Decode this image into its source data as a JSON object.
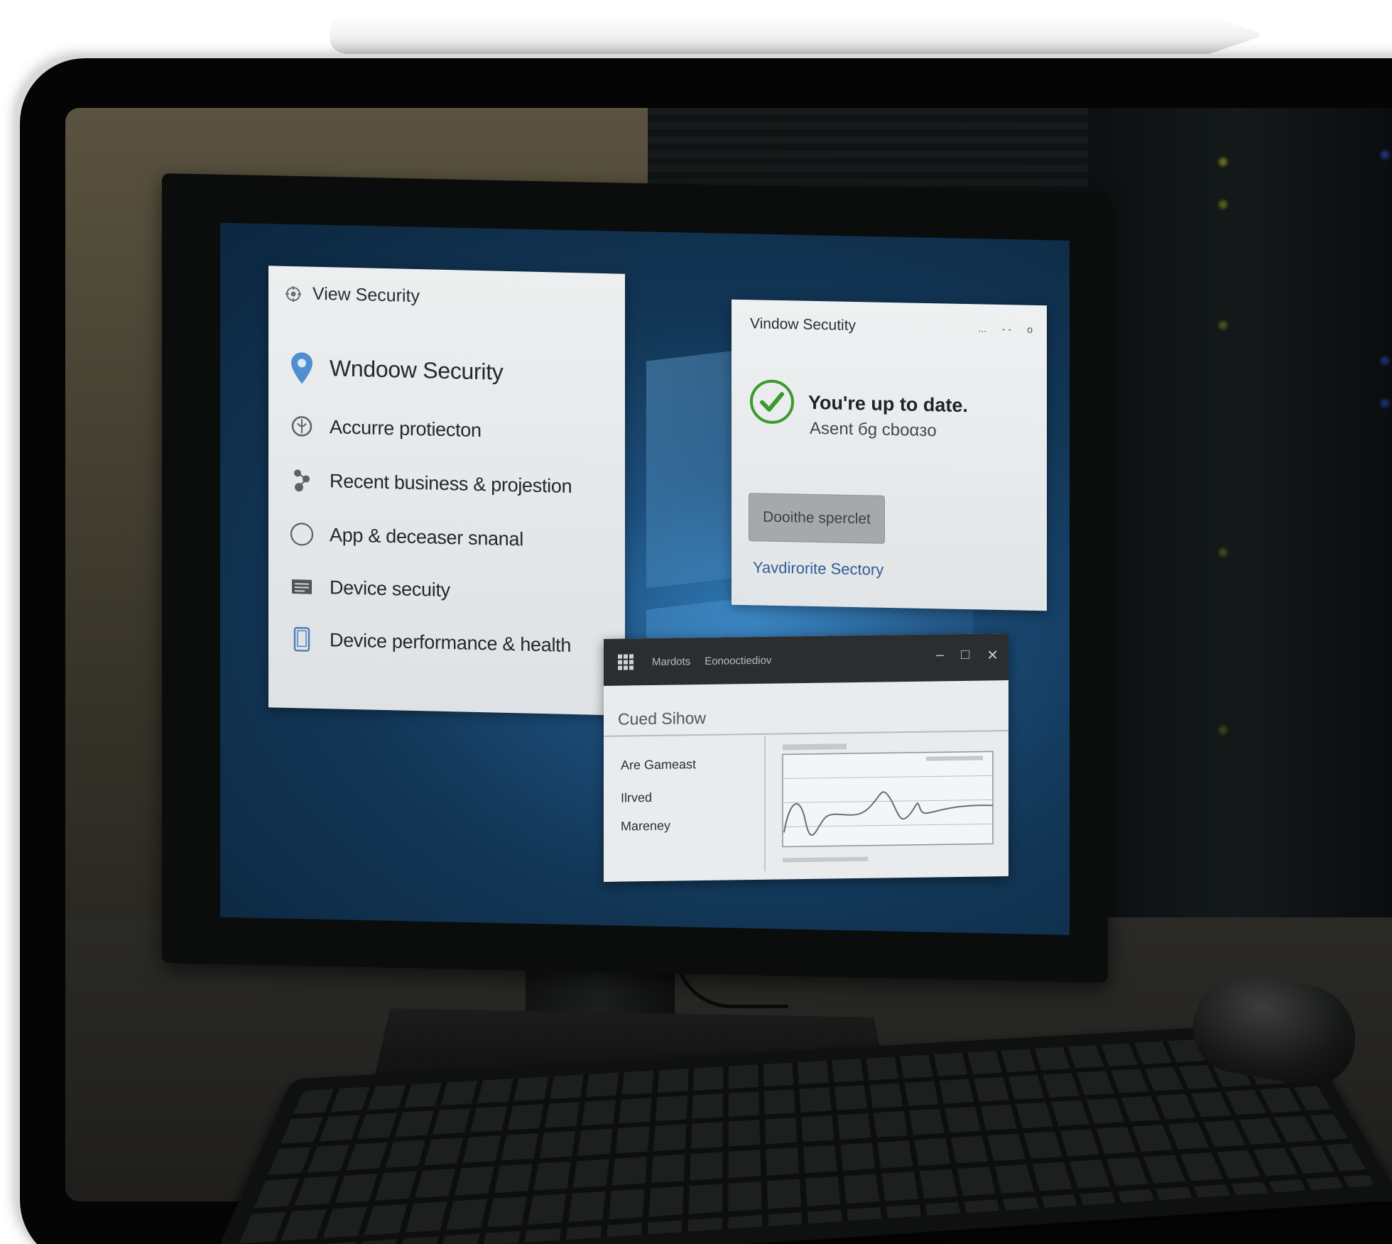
{
  "colors": {
    "accent_blue": "#2f5d98",
    "success_green": "#3a9a2e",
    "desktop_blue": "#1c4d7a",
    "panel_bg": "#e5e8ea",
    "titlebar_dark": "#2a2e31"
  },
  "security_panel": {
    "title": "View Security",
    "title_icon": "shield-gear-icon",
    "items": [
      {
        "label": "Wndoow Security",
        "icon": "location-pin-icon"
      },
      {
        "label": "Accurre protiecton",
        "icon": "virus-shield-icon"
      },
      {
        "label": "Recent business & projestion",
        "icon": "network-icon"
      },
      {
        "label": "App & deceaser snanal",
        "icon": "circle-icon"
      },
      {
        "label": "Device secuity",
        "icon": "chip-icon"
      },
      {
        "label": "Device performance & health",
        "icon": "device-icon"
      }
    ]
  },
  "status_window": {
    "title": "Vindow Secutity",
    "window_controls": [
      "...",
      "- -",
      "o"
    ],
    "status_icon": "checkmark-circle-icon",
    "headline": "You're up to date.",
    "subline": "Asent бg cboαзo",
    "button_label": "Dooithe sperclet",
    "link_text": "Yavdirorite Sectory"
  },
  "chart_window": {
    "app_icon": "grid-icon",
    "titlebar_left": "Mardots",
    "titlebar_right": "Eonooctiediov",
    "controls": [
      "–",
      "□",
      "✕"
    ],
    "heading": "Cued Sihow",
    "metrics": [
      "Are Gameast",
      "Ilrved",
      "Mareney"
    ]
  }
}
